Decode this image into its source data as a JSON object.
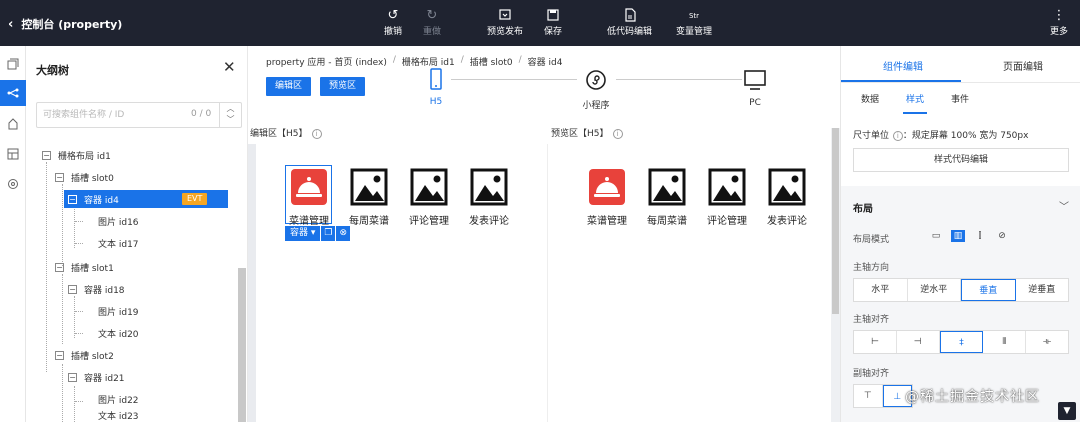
{
  "topbar": {
    "title": "控制台 (property)",
    "buttons": {
      "undo": "撤销",
      "redo": "重做",
      "preview_publish": "预览发布",
      "save": "保存",
      "lowcode_edit": "低代码编辑",
      "var_manage": "变量管理",
      "more": "更多"
    },
    "var_icon_text": "Str"
  },
  "rail_icons": [
    "pages-icon",
    "outline-tree-icon",
    "components-icon",
    "datasource-icon",
    "settings-icon"
  ],
  "outline": {
    "title": "大纲树",
    "search_placeholder": "可搜索组件名称 / ID",
    "count": "0 / 0",
    "nodes": [
      {
        "label": "栅格布局 id1",
        "toggle": "−"
      },
      {
        "label": "插槽 slot0",
        "toggle": "−"
      },
      {
        "label": "容器 id4",
        "toggle": "−",
        "badge": "EVT"
      },
      {
        "label": "图片 id16"
      },
      {
        "label": "文本 id17"
      },
      {
        "label": "插槽 slot1",
        "toggle": "−"
      },
      {
        "label": "容器 id18",
        "toggle": "−"
      },
      {
        "label": "图片 id19"
      },
      {
        "label": "文本 id20"
      },
      {
        "label": "插槽 slot2",
        "toggle": "−"
      },
      {
        "label": "容器 id21",
        "toggle": "−"
      },
      {
        "label": "图片 id22"
      },
      {
        "label": "文本 id23"
      }
    ]
  },
  "breadcrumb": [
    "property 应用 - 首页 (index)",
    "栅格布局 id1",
    "插槽 slot0",
    "容器 id4"
  ],
  "modes": {
    "edit": "编辑区",
    "preview": "预览区"
  },
  "devices": {
    "h5": "H5",
    "mini": "小程序",
    "pc": "PC"
  },
  "edit_area": {
    "header": "编辑区【H5】",
    "selection_label": "容器"
  },
  "preview_area": {
    "header": "预览区【H5】"
  },
  "grid_items": [
    {
      "label": "菜谱管理",
      "icon": "cloche-icon"
    },
    {
      "label": "每周菜谱",
      "icon": "image-placeholder-icon"
    },
    {
      "label": "评论管理",
      "icon": "image-placeholder-icon"
    },
    {
      "label": "发表评论",
      "icon": "image-placeholder-icon"
    }
  ],
  "right_panel": {
    "tabs": [
      "组件编辑",
      "页面编辑"
    ],
    "subtabs": [
      "数据",
      "样式",
      "事件"
    ],
    "unit_label": "尺寸单位",
    "unit_value": "规定屏幕 100% 宽为 750px",
    "style_code_button": "样式代码编辑",
    "layout_section": "布局",
    "layout_mode_label": "布局模式",
    "main_axis_dir_label": "主轴方向",
    "main_axis_dirs": [
      "水平",
      "逆水平",
      "垂直",
      "逆垂直"
    ],
    "main_axis_align_label": "主轴对齐",
    "cross_axis_align_label": "副轴对齐"
  },
  "watermark": "@稀土掘金技术社区",
  "colors": {
    "accent": "#1a73e8",
    "topbar": "#1f2330",
    "badge": "#f5a623",
    "red_icon": "#e8423b"
  }
}
